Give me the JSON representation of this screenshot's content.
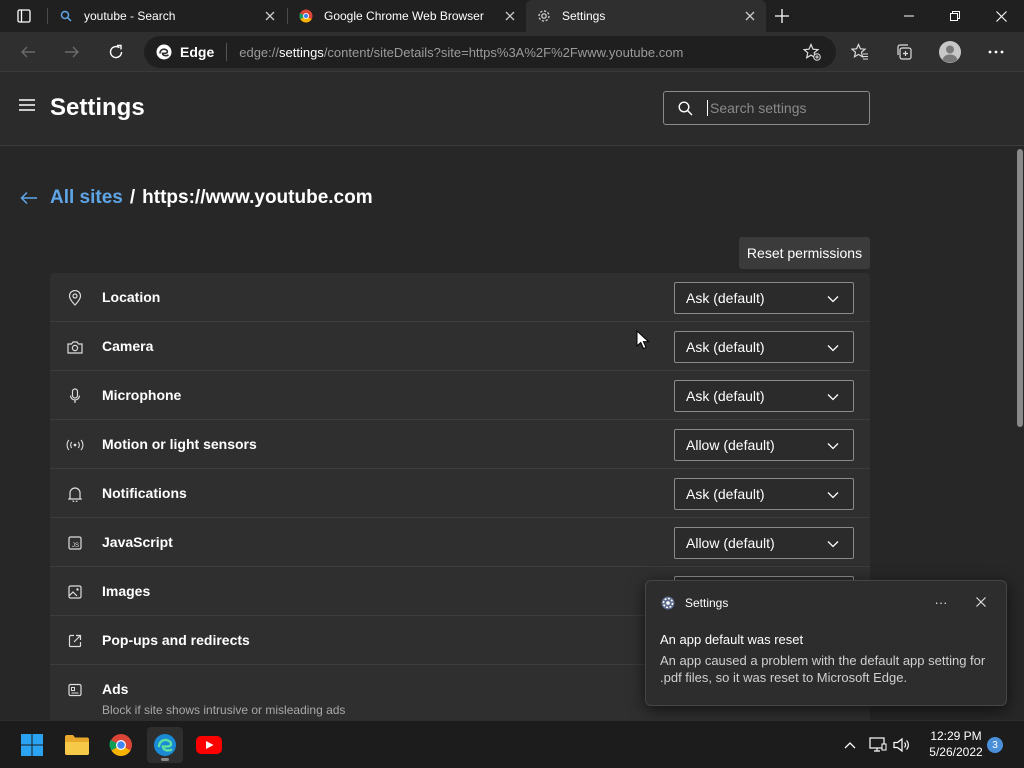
{
  "tabs": [
    {
      "title": "youtube - Search",
      "icon": "search-icon"
    },
    {
      "title": "Google Chrome Web Browser",
      "icon": "chrome-icon"
    },
    {
      "title": "Settings",
      "icon": "gear-icon",
      "active": true
    }
  ],
  "toolbar": {
    "edge_label": "Edge",
    "url_prefix": "edge://",
    "url_host": "settings",
    "url_path": "/content/siteDetails?site=https%3A%2F%2Fwww.youtube.com"
  },
  "header": {
    "title": "Settings",
    "search_placeholder": "Search settings"
  },
  "breadcrumb": {
    "parent": "All sites",
    "separator": "/",
    "current": "https://www.youtube.com"
  },
  "reset_label": "Reset permissions",
  "permissions": [
    {
      "label": "Location",
      "value": "Ask (default)",
      "icon": "location-pin-icon"
    },
    {
      "label": "Camera",
      "value": "Ask (default)",
      "icon": "camera-icon"
    },
    {
      "label": "Microphone",
      "value": "Ask (default)",
      "icon": "microphone-icon"
    },
    {
      "label": "Motion or light sensors",
      "value": "Allow (default)",
      "icon": "sensor-icon"
    },
    {
      "label": "Notifications",
      "value": "Ask (default)",
      "icon": "bell-icon"
    },
    {
      "label": "JavaScript",
      "value": "Allow (default)",
      "icon": "javascript-icon"
    },
    {
      "label": "Images",
      "value": "",
      "icon": "image-icon"
    },
    {
      "label": "Pop-ups and redirects",
      "value": "",
      "icon": "popup-icon"
    },
    {
      "label": "Ads",
      "value": "",
      "icon": "ads-icon",
      "description": "Block if site shows intrusive or misleading ads"
    }
  ],
  "toast": {
    "app": "Settings",
    "title": "An app default was reset",
    "body": "An app caused a problem with the default app setting for .pdf files, so it was reset to Microsoft Edge.",
    "more": "···"
  },
  "taskbar": {
    "time": "12:29 PM",
    "date": "5/26/2022",
    "notification_count": "3"
  },
  "colors": {
    "accent_link": "#5ea5e8",
    "background": "#272727"
  }
}
